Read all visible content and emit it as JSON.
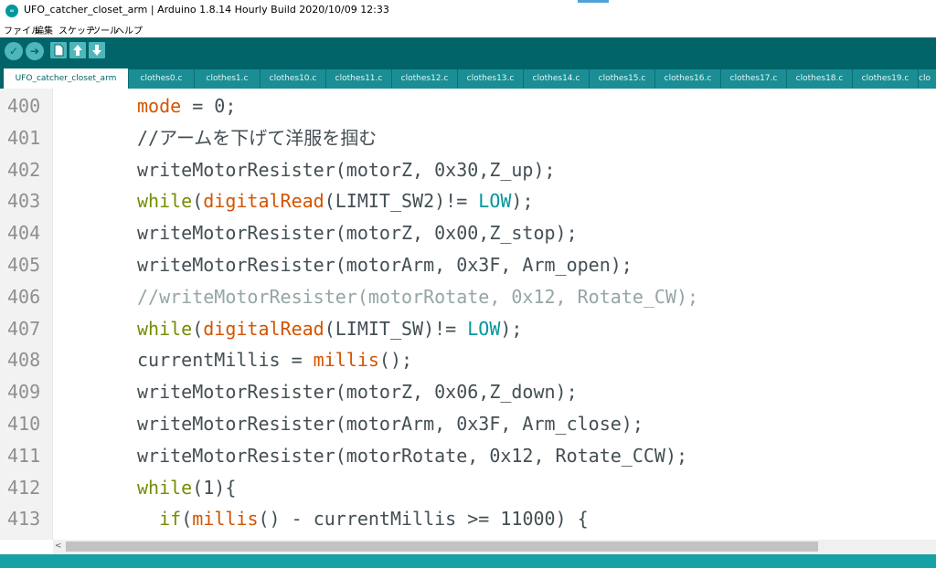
{
  "window": {
    "app_icon_label": "∞",
    "title": "UFO_catcher_closet_arm | Arduino 1.8.14 Hourly Build 2020/10/09 12:33"
  },
  "menu": [
    "ファイル",
    "編集",
    "スケッチ",
    "ツール",
    "ヘルプ"
  ],
  "toolbar": {
    "verify_icon": "check-icon",
    "upload_icon": "arrow-right-icon",
    "new_icon": "new-file-icon",
    "open_icon": "arrow-up-icon",
    "save_icon": "arrow-down-icon",
    "verify_glyph": "✓",
    "upload_glyph": "➔"
  },
  "tabs": [
    "UFO_catcher_closet_arm",
    "clothes0.c",
    "clothes1.c",
    "clothes10.c",
    "clothes11.c",
    "clothes12.c",
    "clothes13.c",
    "clothes14.c",
    "clothes15.c",
    "clothes16.c",
    "clothes17.c",
    "clothes18.c",
    "clothes19.c",
    "clo"
  ],
  "active_tab_index": 0,
  "editor": {
    "lines": [
      {
        "num": "400",
        "tokens": [
          [
            "mode",
            "orange"
          ],
          [
            " = 0;",
            ""
          ]
        ]
      },
      {
        "num": "401",
        "tokens": [
          [
            "//アームを下げて洋服を掴む",
            ""
          ]
        ]
      },
      {
        "num": "402",
        "tokens": [
          [
            "writeMotorResister(motorZ, 0x30,Z_up);",
            ""
          ]
        ]
      },
      {
        "num": "403",
        "tokens": [
          [
            "while",
            "green"
          ],
          [
            "(",
            ""
          ],
          [
            "digitalRead",
            "orange"
          ],
          [
            "(LIMIT_SW2)!= ",
            ""
          ],
          [
            "LOW",
            "teal"
          ],
          [
            ");",
            ""
          ]
        ]
      },
      {
        "num": "404",
        "tokens": [
          [
            "writeMotorResister(motorZ, 0x00,Z_stop);",
            ""
          ]
        ]
      },
      {
        "num": "405",
        "tokens": [
          [
            "writeMotorResister(motorArm, 0x3F, Arm_open);",
            ""
          ]
        ]
      },
      {
        "num": "406",
        "tokens": [
          [
            "//writeMotorResister(motorRotate, 0x12, Rotate_CW);",
            "grey"
          ]
        ]
      },
      {
        "num": "407",
        "tokens": [
          [
            "while",
            "green"
          ],
          [
            "(",
            ""
          ],
          [
            "digitalRead",
            "orange"
          ],
          [
            "(LIMIT_SW)!= ",
            ""
          ],
          [
            "LOW",
            "teal"
          ],
          [
            ");",
            ""
          ]
        ]
      },
      {
        "num": "408",
        "tokens": [
          [
            "currentMillis = ",
            ""
          ],
          [
            "millis",
            "orange"
          ],
          [
            "();",
            ""
          ]
        ]
      },
      {
        "num": "409",
        "tokens": [
          [
            "writeMotorResister(motorZ, 0x06,Z_down);",
            ""
          ]
        ]
      },
      {
        "num": "410",
        "tokens": [
          [
            "writeMotorResister(motorArm, 0x3F, Arm_close);",
            ""
          ]
        ]
      },
      {
        "num": "411",
        "tokens": [
          [
            "writeMotorResister(motorRotate, 0x12, Rotate_CCW);",
            ""
          ]
        ]
      },
      {
        "num": "412",
        "tokens": [
          [
            "while",
            "green"
          ],
          [
            "(1){",
            ""
          ]
        ]
      },
      {
        "num": "413",
        "tokens": [
          [
            "  ",
            ""
          ],
          [
            "if",
            "green"
          ],
          [
            "(",
            ""
          ],
          [
            "millis",
            "orange"
          ],
          [
            "() - currentMillis >= 11000) {",
            ""
          ]
        ]
      }
    ]
  },
  "scrollbar": {
    "left_arrow": "<"
  },
  "colors": {
    "toolbar_bg": "#006468",
    "tab_bg": "#1a8e94",
    "status_bg": "#17a1a5",
    "keyword_orange": "#d35400",
    "keyword_green": "#728e00",
    "constant_teal": "#00979c",
    "comment_grey": "#95a5a6"
  }
}
